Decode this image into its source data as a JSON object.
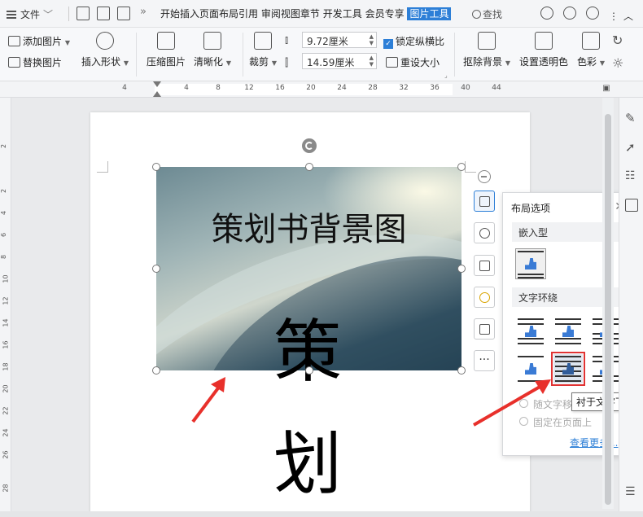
{
  "menubar": {
    "file_label": "文件",
    "tabs": [
      "开始",
      "插入",
      "页面布局",
      "引用",
      "审阅",
      "视图",
      "章节",
      "开发工具",
      "会员专享"
    ],
    "active_tab": "图片工具",
    "search_label": "查找"
  },
  "ribbon": {
    "add_image": "添加图片",
    "replace_image": "替换图片",
    "insert_shape": "插入形状",
    "compress": "压缩图片",
    "sharpen": "清晰化",
    "crop": "裁剪",
    "height_value": "9.72厘米",
    "width_value": "14.59厘米",
    "lock_ratio": "锁定纵横比",
    "reset_size": "重设大小",
    "remove_bg": "抠除背景",
    "set_transparent": "设置透明色",
    "color": "色彩"
  },
  "ruler": {
    "ticks": [
      "4",
      "4",
      "8",
      "12",
      "16",
      "20",
      "24",
      "28",
      "32",
      "36",
      "40",
      "44"
    ],
    "vticks": [
      "2",
      "2",
      "4",
      "6",
      "8",
      "10",
      "12",
      "14",
      "16",
      "18",
      "20",
      "22",
      "24",
      "26",
      "28"
    ]
  },
  "document": {
    "image_title": "策划书背景图",
    "char1": "策",
    "char2": "划"
  },
  "layout_panel": {
    "title": "布局选项",
    "section_inline": "嵌入型",
    "section_wrap": "文字环绕",
    "radio1": "随文字移动",
    "radio2": "固定在页面上",
    "view_more": "查看更多...",
    "tooltip": "衬于文字下方"
  },
  "colors": {
    "accent": "#2d7fd7",
    "highlight": "#e03333",
    "arrow": "#e8302b"
  }
}
